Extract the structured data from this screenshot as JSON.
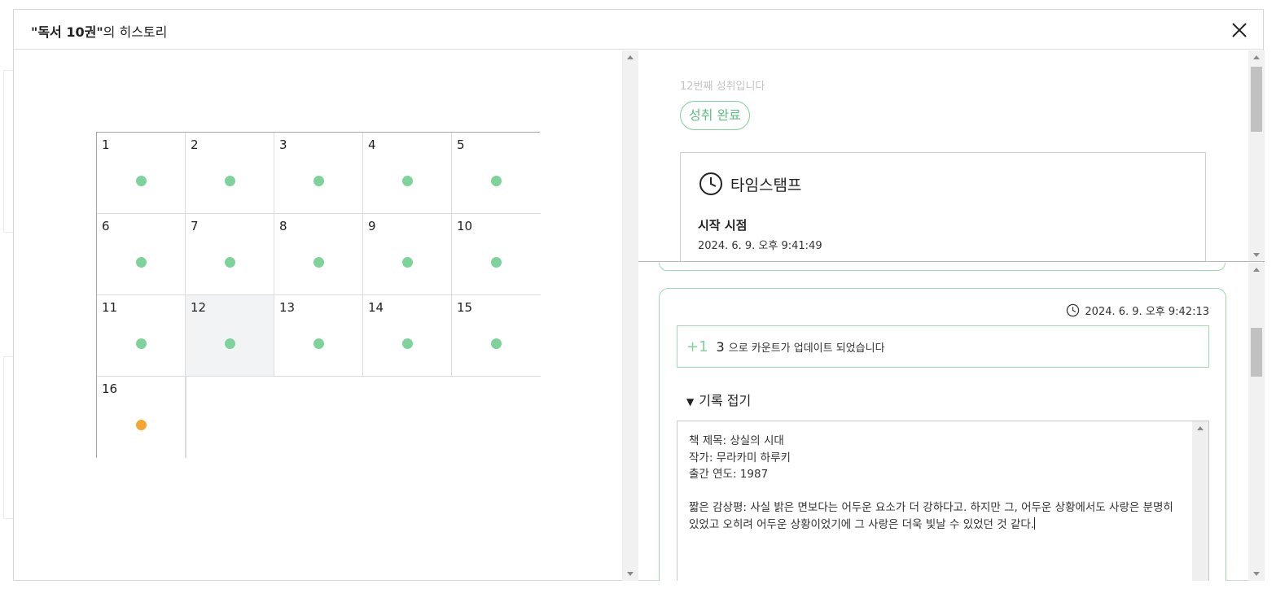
{
  "modal": {
    "title_name": "\"독서 10권\"",
    "title_suffix": "의 히스토리"
  },
  "grid": {
    "cells": [
      {
        "num": "1",
        "status": "done"
      },
      {
        "num": "2",
        "status": "done"
      },
      {
        "num": "3",
        "status": "done"
      },
      {
        "num": "4",
        "status": "done"
      },
      {
        "num": "5",
        "status": "done"
      },
      {
        "num": "6",
        "status": "done"
      },
      {
        "num": "7",
        "status": "done"
      },
      {
        "num": "8",
        "status": "done"
      },
      {
        "num": "9",
        "status": "done"
      },
      {
        "num": "10",
        "status": "done"
      },
      {
        "num": "11",
        "status": "done"
      },
      {
        "num": "12",
        "status": "done",
        "selected": true
      },
      {
        "num": "13",
        "status": "done"
      },
      {
        "num": "14",
        "status": "done"
      },
      {
        "num": "15",
        "status": "done"
      },
      {
        "num": "16",
        "status": "pending"
      }
    ],
    "colors": {
      "done": "#7dd39a",
      "pending": "#f7a531",
      "selected_bg": "#f2f3f5"
    }
  },
  "detail": {
    "nth_text": "12번째 성취입니다",
    "chip_label": "성취 완료",
    "timestamp_title": "타임스탬프",
    "start_label": "시작 시점",
    "start_value": "2024. 6. 9. 오후 9:41:49"
  },
  "entry": {
    "time": "2024. 6. 9. 오후 9:42:13",
    "plus": "+1",
    "count": "3",
    "update_message": "으로 카운트가 업데이트 되었습니다",
    "toggle_label": "기록 접기",
    "note": "책 제목: 상실의 시대\n작가: 무라카미 하루키\n출간 연도: 1987\n\n짧은 감상평: 사실 밝은 면보다는 어두운 요소가 더 강하다고. 하지만 그, 어두운 상황에서도 사랑은 분명히 있었고 오히려 어두운 상황이었기에 그 사랑은 더욱 빛날 수 있었던 것 같다."
  },
  "icons": {
    "close": "close-icon",
    "clock": "clock-icon",
    "triangle": "triangle-down-icon"
  }
}
